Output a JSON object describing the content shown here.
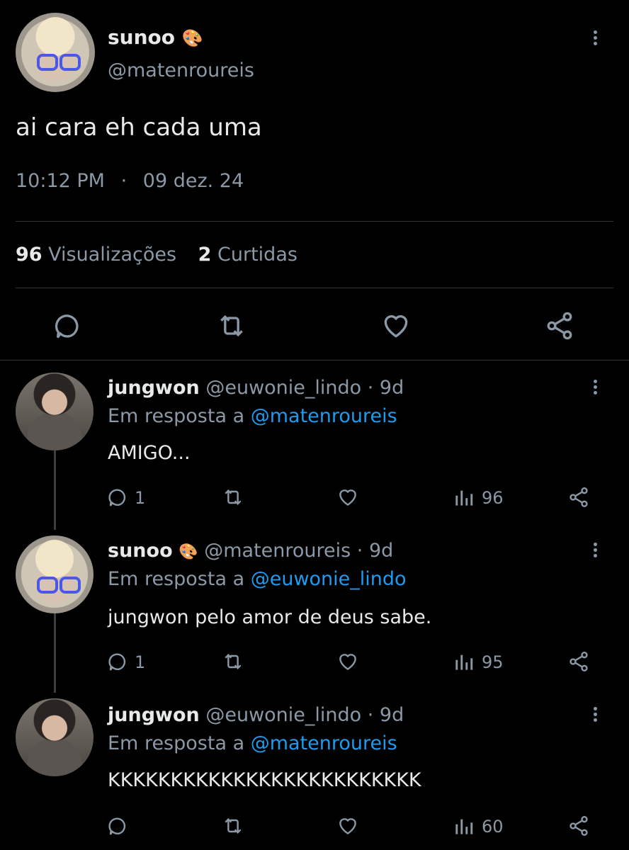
{
  "main_tweet": {
    "display_name": "sunoo",
    "emoji": "🎨",
    "handle": "@matenroureis",
    "text": "ai cara eh cada uma",
    "time": "10:12 PM",
    "separator": "·",
    "date": "09 dez. 24",
    "views_count": "96",
    "views_label": "Visualizações",
    "likes_count": "2",
    "likes_label": "Curtidas"
  },
  "replies": [
    {
      "display_name": "jungwon",
      "handle": "@euwonie_lindo",
      "age": "· 9d",
      "reply_prefix": "Em resposta a",
      "reply_to": "@matenroureis",
      "text": "AMIGO...",
      "reply_count": "1",
      "views": "96"
    },
    {
      "display_name": "sunoo",
      "emoji": "🎨",
      "handle": "@matenroureis",
      "age": "· 9d",
      "reply_prefix": "Em resposta a",
      "reply_to": "@euwonie_lindo",
      "text": "jungwon pelo amor de deus sabe.",
      "reply_count": "1",
      "views": "95"
    },
    {
      "display_name": "jungwon",
      "handle": "@euwonie_lindo",
      "age": "· 9d",
      "reply_prefix": "Em resposta a",
      "reply_to": "@matenroureis",
      "text": "KKKKKKKKKKKKKKKKKKKKKKKKK",
      "reply_count": "",
      "views": "60"
    }
  ],
  "colors": {
    "background": "#000000",
    "link": "#1d9bf0",
    "muted": "#8b98a5",
    "text": "#e7e9ea"
  }
}
